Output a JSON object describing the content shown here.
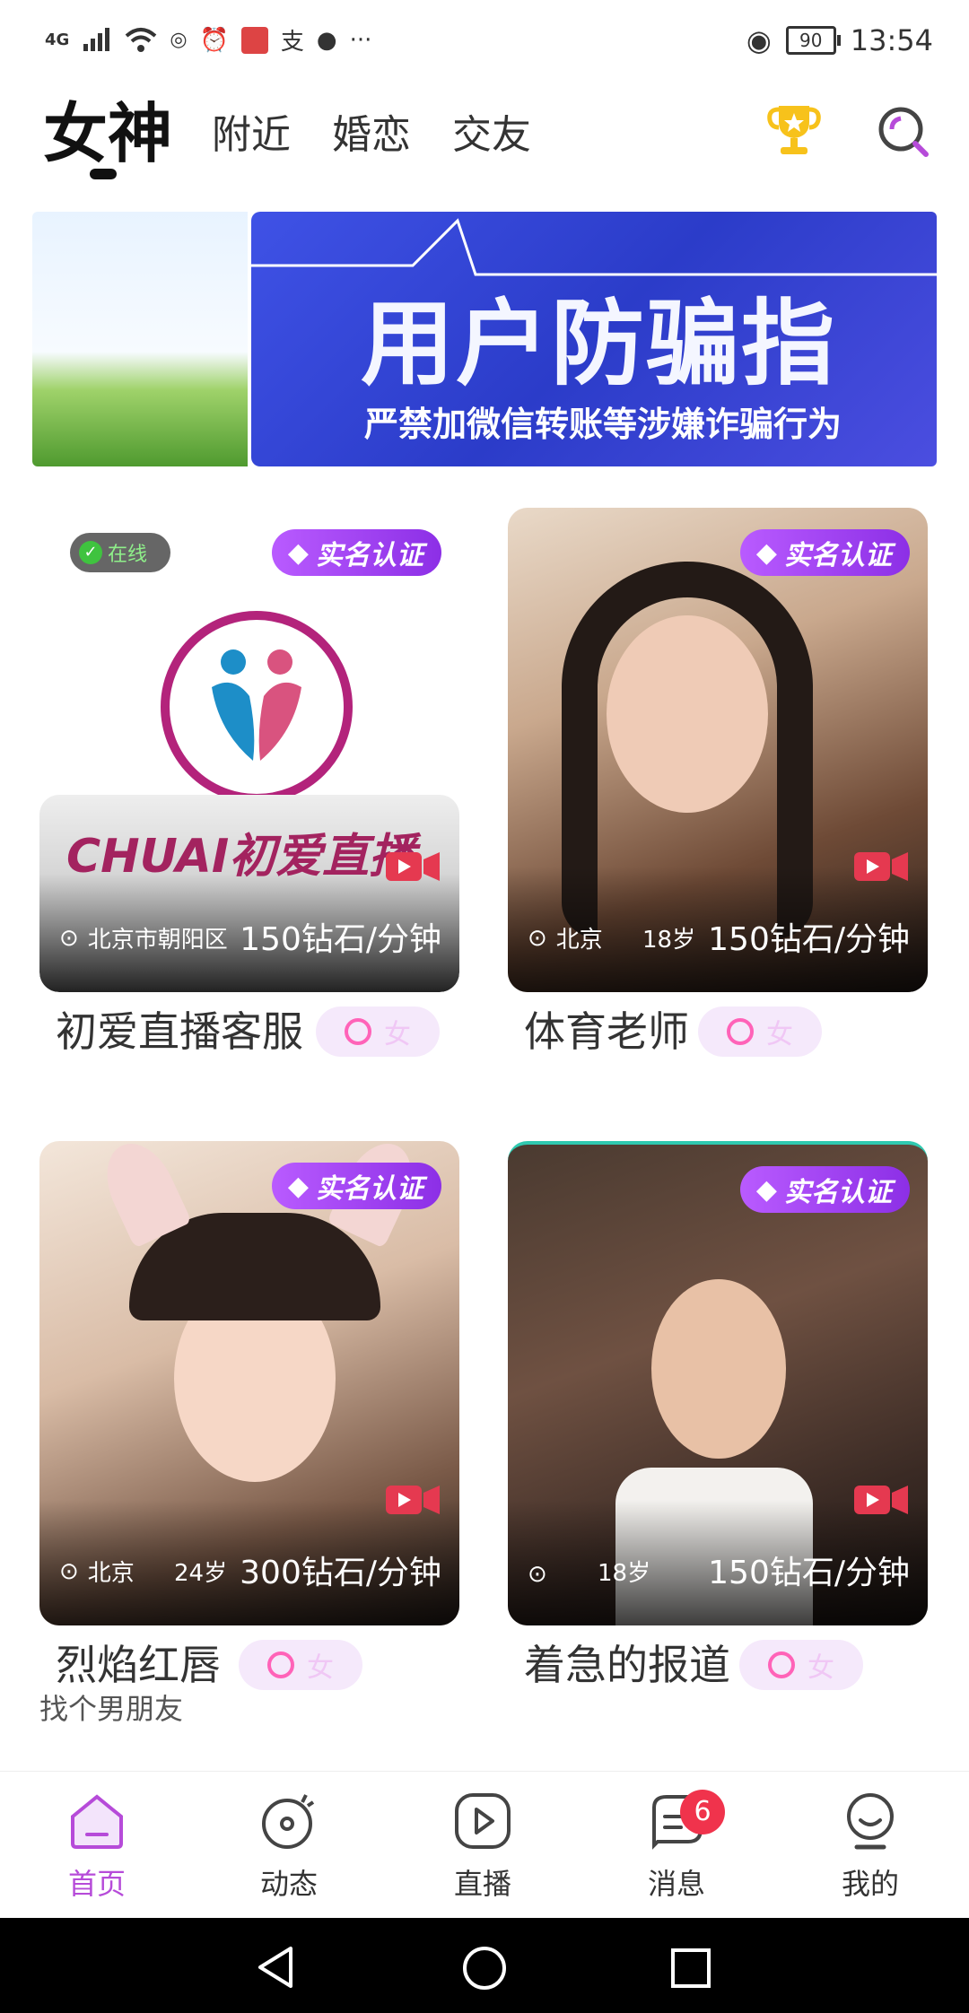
{
  "status_bar": {
    "network": "4G",
    "battery": "90",
    "time": "13:54"
  },
  "header": {
    "tabs": [
      "女神",
      "附近",
      "婚恋",
      "交友"
    ],
    "active_tab": "女神"
  },
  "banner": {
    "title": "用户防骗指",
    "subtitle": "严禁加微信转账等涉嫌诈骗行为"
  },
  "cards": [
    {
      "badge": "实名认证",
      "online": "在线",
      "logo_text": "CHUAI初爱直播",
      "location": "北京市朝阳区",
      "age": "",
      "price": "150钻石/分钟",
      "name": "初爱直播客服",
      "gender": "女",
      "subtitle": ""
    },
    {
      "badge": "实名认证",
      "location": "北京",
      "age": "18岁",
      "price": "150钻石/分钟",
      "name": "体育老师",
      "gender": "女",
      "subtitle": ""
    },
    {
      "badge": "实名认证",
      "location": "北京",
      "age": "24岁",
      "price": "300钻石/分钟",
      "name": "烈焰红唇",
      "gender": "女",
      "subtitle": "找个男朋友"
    },
    {
      "badge": "实名认证",
      "location": "",
      "age": "18岁",
      "price": "150钻石/分钟",
      "name": "着急的报道",
      "gender": "女",
      "subtitle": ""
    }
  ],
  "bottom_nav": [
    {
      "label": "首页",
      "icon": "home-icon",
      "active": true
    },
    {
      "label": "动态",
      "icon": "moments-icon"
    },
    {
      "label": "直播",
      "icon": "live-icon"
    },
    {
      "label": "消息",
      "icon": "message-icon",
      "badge": "6"
    },
    {
      "label": "我的",
      "icon": "profile-icon"
    }
  ],
  "colors": {
    "accent": "#b64bd9",
    "badge_purple": "#9b3ef0",
    "banner_blue": "#3445d6"
  }
}
